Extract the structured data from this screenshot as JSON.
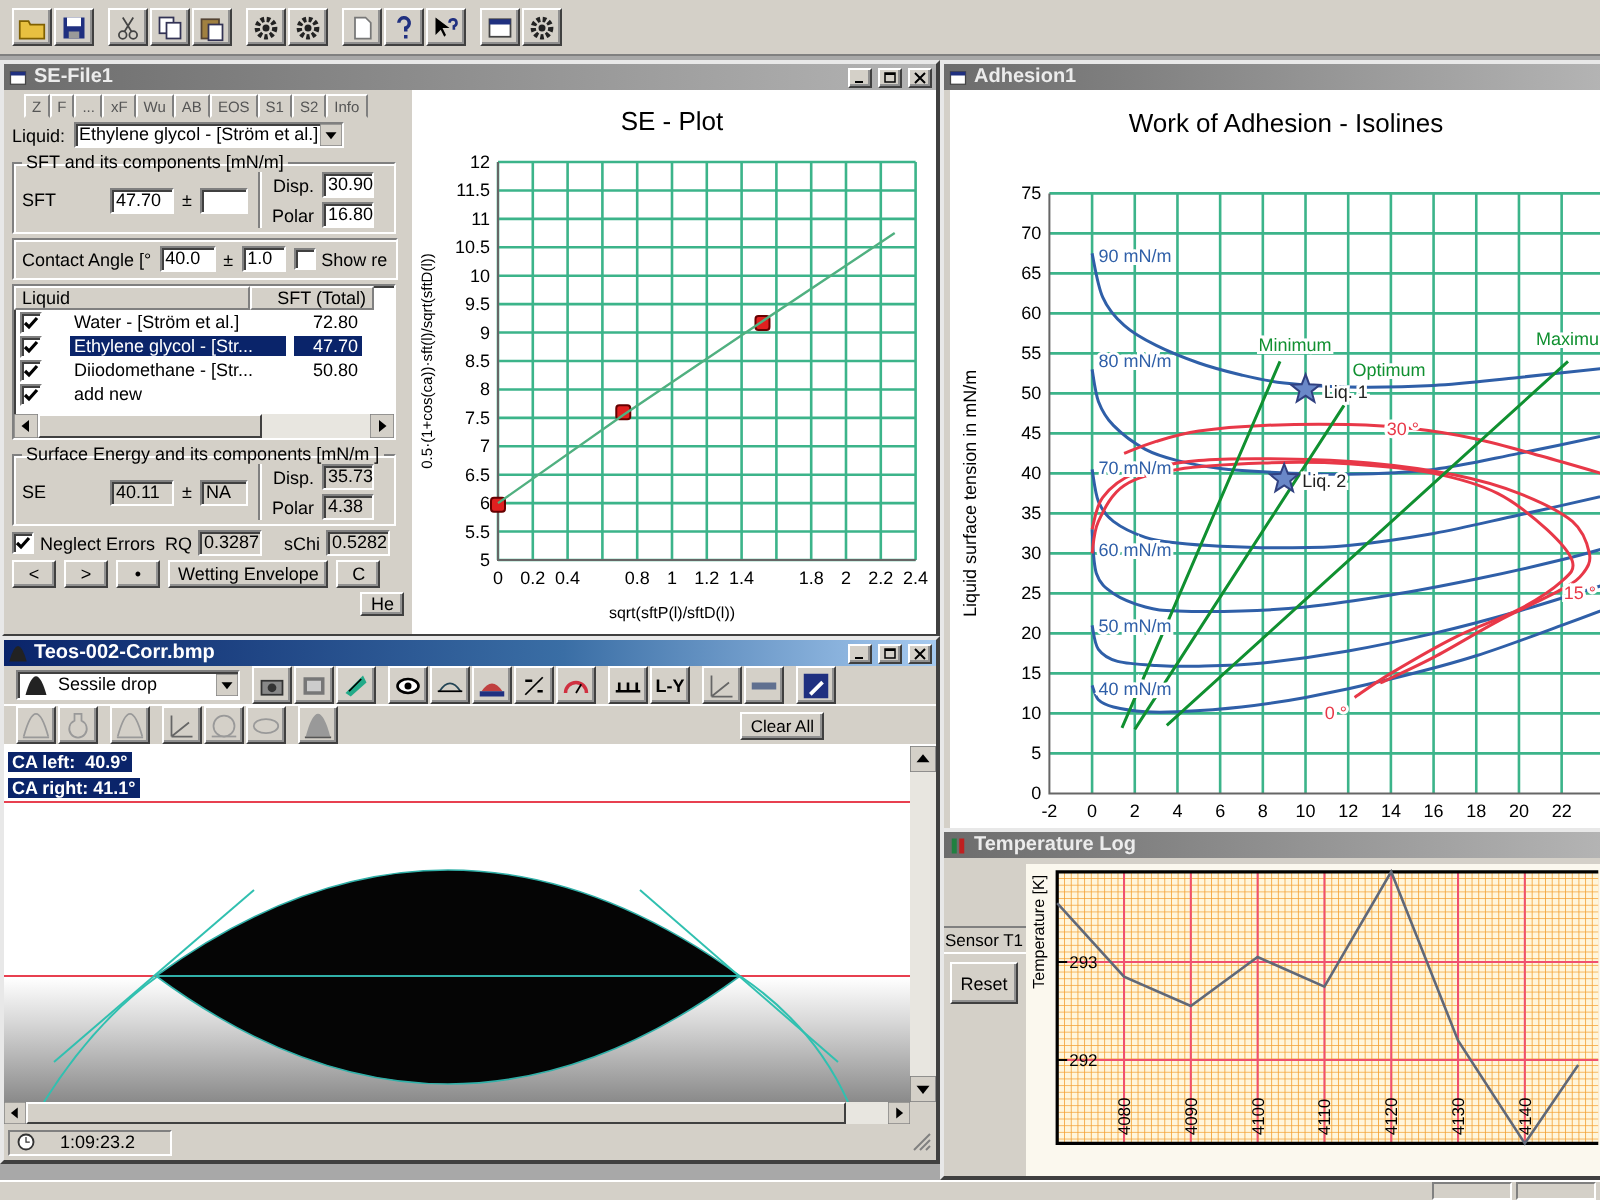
{
  "se_file": {
    "title": "SE-File1",
    "active": false,
    "tabs": [
      {
        "label": "Z",
        "selected": false
      },
      {
        "label": "F",
        "selected": false
      },
      {
        "label": "...",
        "selected": false
      },
      {
        "label": "xF",
        "selected": false
      },
      {
        "label": "Wu",
        "selected": false
      },
      {
        "label": "AB",
        "selected": false
      },
      {
        "label": "EOS",
        "selected": false
      },
      {
        "label": "S1",
        "selected": false
      },
      {
        "label": "S2",
        "selected": false
      },
      {
        "label": "Info",
        "selected": false
      }
    ],
    "liquid": {
      "label": "Liquid:",
      "value": "Ethylene glycol - [Ström et al.]"
    },
    "sft_group": {
      "title": "SFT and its components [mN/m]",
      "sft_label": "SFT",
      "sft": "47.70",
      "pm": "±",
      "disp_label": "Disp.",
      "disp": "30.90",
      "polar_label": "Polar",
      "polar": "16.80"
    },
    "contact_angle": {
      "label": "Contact Angle [°",
      "value": "40.0",
      "pm": "±",
      "error": "1.0",
      "show_label": "Show re",
      "show_checked": false
    },
    "liquid_list": {
      "columns": [
        "Liquid",
        "SFT (Total)"
      ],
      "rows": [
        {
          "name": "Water - [Ström et al.]",
          "sft": "72.80",
          "checked": true,
          "selected": false
        },
        {
          "name": "Ethylene glycol - [Str...",
          "sft": "47.70",
          "checked": true,
          "selected": true
        },
        {
          "name": "Diiodomethane - [Str...",
          "sft": "50.80",
          "checked": true,
          "selected": false
        },
        {
          "name": "add new",
          "checked": true,
          "selected": false
        }
      ]
    },
    "se_group": {
      "title": "Surface Energy and its components [mN/m ]",
      "se_label": "SE",
      "se": "40.11",
      "pm": "±",
      "se_error": "NA",
      "disp_label": "Disp.",
      "disp": "35.73",
      "polar_label": "Polar",
      "polar": "4.38"
    },
    "neglect": {
      "label": "Neglect Errors",
      "checked": true
    },
    "rq_label": "RQ",
    "rq": "0.3287",
    "schi_label": "sChi",
    "schi": "0.5282",
    "buttons": [
      "<",
      ">",
      "•",
      "Wetting Envelope",
      "C"
    ],
    "help_button": "He"
  },
  "se_plot": {
    "chart_data": {
      "type": "scatter",
      "title": "SE - Plot",
      "xlabel": "sqrt(sftP(l)/sftD(l))",
      "ylabel": "0.5·(1+cos(ca))·sft(l)/sqrt(sftD(l))",
      "x": [
        0,
        0.72,
        1.52,
        2.28
      ],
      "grid": true,
      "series": [
        {
          "color": "#e02020",
          "values": [
            5.97,
            7.6,
            9.17,
            null
          ]
        },
        {
          "type": "line",
          "color": "#50b080",
          "values": [
            6.0,
            7.55,
            9.2,
            10.75
          ]
        }
      ],
      "xlim": [
        0,
        2.4
      ],
      "ylim": [
        5,
        12
      ],
      "xticks": [
        0,
        0.2,
        0.4,
        0.8,
        1,
        1.2,
        1.4,
        1.8,
        2,
        2.2,
        2.4
      ],
      "yticks": [
        5,
        5.5,
        6,
        6.5,
        7,
        7.5,
        8,
        8.5,
        9,
        9.5,
        10,
        10.5,
        11,
        11.5,
        12
      ]
    }
  },
  "adhesion": {
    "title": "Adhesion1",
    "active": false,
    "chart_data": {
      "type": "line",
      "title": "Work of Adhesion - Isolines",
      "ylabel": "Liquid surface tension in mN/m",
      "xlim": [
        -2,
        24.5
      ],
      "ylim": [
        0,
        75
      ],
      "grid": true,
      "xticks": [
        -2,
        0,
        2,
        4,
        6,
        8,
        10,
        12,
        14,
        16,
        18,
        20,
        22
      ],
      "yticks": [
        0,
        5,
        10,
        15,
        20,
        25,
        30,
        35,
        40,
        45,
        50,
        55,
        60,
        65,
        70,
        75
      ],
      "series": [
        {
          "color": "#2f5fa8",
          "x": [
            0,
            0.5,
            1.5,
            3,
            5,
            7,
            9,
            12,
            16,
            20,
            24.5
          ],
          "values": [
            67.5,
            62,
            58.5,
            56,
            53.8,
            52.3,
            51.3,
            50.8,
            51,
            52,
            53.3
          ]
        },
        {
          "color": "#2f5fa8",
          "x": [
            0,
            0.3,
            1,
            2.5,
            4,
            6,
            8,
            12,
            16,
            20,
            24.5
          ],
          "values": [
            53,
            49,
            46,
            43,
            41.6,
            40.6,
            40.2,
            39.9,
            40.5,
            42.5,
            45
          ]
        },
        {
          "color": "#2f5fa8",
          "x": [
            0,
            0.3,
            1,
            2.5,
            4,
            6,
            9,
            12,
            16,
            20,
            24.5
          ],
          "values": [
            40.5,
            36.5,
            34,
            32,
            31.3,
            30.9,
            30.7,
            31,
            32.5,
            34.8,
            37.5
          ]
        },
        {
          "color": "#2f5fa8",
          "x": [
            0,
            0.2,
            1,
            2.5,
            4,
            7,
            10,
            14,
            18,
            22,
            24.5
          ],
          "values": [
            33,
            27.5,
            25,
            23.3,
            22.8,
            22.8,
            23.3,
            24.8,
            26.8,
            29.2,
            31
          ]
        },
        {
          "color": "#2f5fa8",
          "x": [
            0,
            0.3,
            1.2,
            3,
            5,
            8,
            12,
            16,
            20,
            24.5
          ],
          "values": [
            21,
            18,
            16.5,
            16,
            15.9,
            16.3,
            17.8,
            20,
            22.8,
            26.5
          ]
        },
        {
          "color": "#2f5fa8",
          "x": [
            0,
            0.3,
            1,
            2.5,
            4,
            7,
            10,
            14,
            18,
            22,
            24.5
          ],
          "values": [
            13.5,
            11.7,
            10.8,
            10.2,
            10.2,
            10.8,
            12,
            14.3,
            17.2,
            21,
            23.5
          ]
        },
        {
          "color": "#e83848",
          "x": [
            1.5,
            3,
            5,
            8,
            12,
            15,
            18,
            21,
            24.5
          ],
          "values": [
            42.5,
            44,
            45.3,
            46,
            46.1,
            45.6,
            44.3,
            42.2,
            39.5
          ]
        },
        {
          "color": "#e83848",
          "x": [
            0,
            0.5,
            2,
            5,
            9,
            13,
            17,
            20,
            22.5,
            23.3,
            23,
            22,
            19,
            16,
            13.5
          ],
          "values": [
            33,
            37,
            40,
            41.6,
            41.8,
            41.3,
            39.8,
            37.5,
            34,
            30,
            27.5,
            25.5,
            21.5,
            17,
            13.8
          ]
        },
        {
          "color": "#e83848",
          "x": [
            0,
            0.3,
            1.5,
            4,
            8,
            12,
            16,
            19,
            21.3,
            22.5,
            22,
            20,
            17,
            14,
            12.3
          ],
          "values": [
            30,
            34,
            38.5,
            40.5,
            41.3,
            41.2,
            40,
            37.5,
            33,
            29,
            26.5,
            23,
            19.5,
            15,
            12
          ]
        },
        {
          "color": "#109030",
          "x": [
            1.4,
            8.8
          ],
          "values": [
            8.2,
            54
          ]
        },
        {
          "color": "#109030",
          "x": [
            2,
            11.8
          ],
          "values": [
            8,
            48.5
          ]
        },
        {
          "color": "#109030",
          "x": [
            3.5,
            22.3
          ],
          "values": [
            8.5,
            54
          ]
        },
        {
          "type": "scatter",
          "color": "#6a88c8",
          "x": [
            10,
            9
          ],
          "values": [
            50.5,
            39.3
          ]
        }
      ],
      "annotations": [
        "90 mN/m",
        "80 mN/m",
        "70 mN/m",
        "60 mN/m",
        "50 mN/m",
        "40 mN/m",
        "30 °",
        "15 °",
        "0 °",
        "Minimum",
        "Optimum",
        "Maximu",
        "Liq. 1",
        "Liq. 2"
      ]
    }
  },
  "image_window": {
    "title": "Teos-002-Corr.bmp",
    "active": true,
    "mode": "Sessile drop",
    "ly_button": "L-Y",
    "clear_button": "Clear All",
    "ca_left": "CA left:  40.9°",
    "ca_right": "CA right: 41.1°",
    "time": "1:09:23.2"
  },
  "temperature_log": {
    "title": "Temperature Log",
    "active": false,
    "sensor": "Sensor T1",
    "reset": "Reset",
    "chart_data": {
      "type": "line",
      "ylabel": "Temperature [K]",
      "grid": true,
      "x": [
        4070,
        4080,
        4090,
        4100,
        4110,
        4120,
        4130,
        4140,
        4148
      ],
      "series": [
        {
          "color": "#606878",
          "values": [
            293.6,
            292.85,
            292.55,
            293.05,
            292.75,
            293.92,
            292.2,
            291.15,
            291.95
          ]
        }
      ],
      "xlim": [
        4070,
        4151
      ],
      "ylim": [
        291.15,
        293.92
      ],
      "xticks": [
        4080,
        4090,
        4100,
        4110,
        4120,
        4130,
        4140
      ],
      "yticks": [
        292,
        293
      ]
    }
  }
}
